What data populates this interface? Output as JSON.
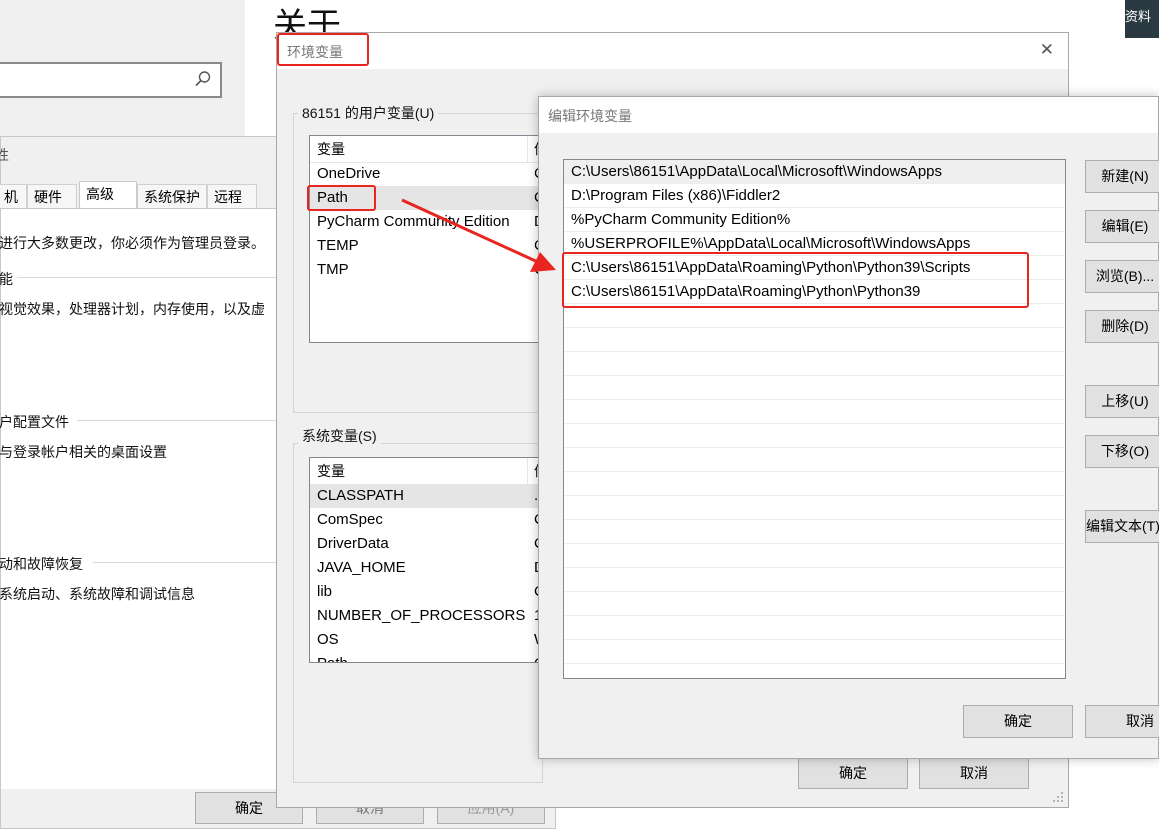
{
  "background": {
    "title": "关于",
    "top_right_text": "资料"
  },
  "system_properties": {
    "title": "性",
    "tabs": [
      "机名",
      "硬件",
      "高级",
      "系统保护",
      "远程"
    ],
    "active_tab": "高级",
    "admin_notice": "进行大多数更改，你必须作为管理员登录。",
    "section1_title": "能",
    "section1_desc": "视觉效果，处理器计划，内存使用，以及虚",
    "section2_title": "户配置文件",
    "section2_desc": "与登录帐户相关的桌面设置",
    "section3_title": "动和故障恢复",
    "section3_desc": "系统启动、系统故障和调试信息",
    "ok_label": "确定",
    "cancel_label": "取消",
    "apply_label": "应用(A)"
  },
  "env_dialog": {
    "title": "环境变量",
    "close_symbol": "✕",
    "user_vars_label": "86151 的用户变量(U)",
    "col_variable": "变量",
    "col_value": "值",
    "user_vars": [
      {
        "name": "OneDrive",
        "value": "C"
      },
      {
        "name": "Path",
        "value": "C"
      },
      {
        "name": "PyCharm Community Edition",
        "value": "D"
      },
      {
        "name": "TEMP",
        "value": "C"
      },
      {
        "name": "TMP",
        "value": "C"
      }
    ],
    "system_vars_label": "系统变量(S)",
    "system_vars": [
      {
        "name": "CLASSPATH",
        "value": "."
      },
      {
        "name": "ComSpec",
        "value": "C"
      },
      {
        "name": "DriverData",
        "value": "C"
      },
      {
        "name": "JAVA_HOME",
        "value": "D"
      },
      {
        "name": "lib",
        "value": "C"
      },
      {
        "name": "NUMBER_OF_PROCESSORS",
        "value": "1"
      },
      {
        "name": "OS",
        "value": "W"
      },
      {
        "name": "Path",
        "value": "C"
      }
    ],
    "ok_label": "确定",
    "cancel_label": "取消"
  },
  "edit_dialog": {
    "title": "编辑环境变量",
    "paths": [
      "C:\\Users\\86151\\AppData\\Local\\Microsoft\\WindowsApps",
      "D:\\Program Files (x86)\\Fiddler2",
      "%PyCharm Community Edition%",
      "%USERPROFILE%\\AppData\\Local\\Microsoft\\WindowsApps",
      "C:\\Users\\86151\\AppData\\Roaming\\Python\\Python39\\Scripts",
      "C:\\Users\\86151\\AppData\\Roaming\\Python\\Python39"
    ],
    "buttons": {
      "new": "新建(N)",
      "edit": "编辑(E)",
      "browse": "浏览(B)...",
      "delete": "删除(D)",
      "move_up": "上移(U)",
      "move_down": "下移(O)",
      "edit_text": "编辑文本(T)..."
    },
    "ok_label": "确定",
    "cancel_label": "取消"
  },
  "colors": {
    "highlight_red": "#e8261f",
    "selected_row": "#e5e5e5"
  }
}
